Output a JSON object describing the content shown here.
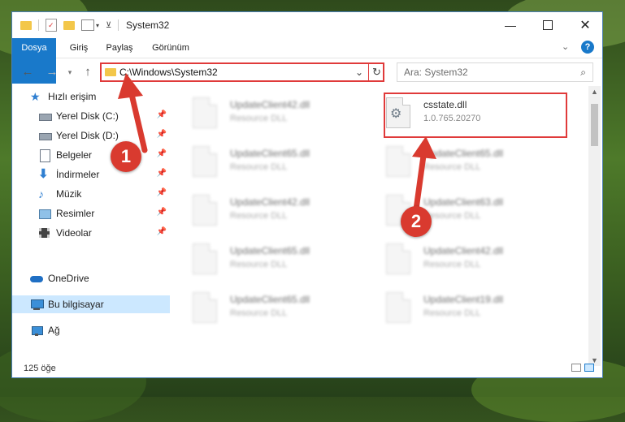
{
  "window": {
    "title": "System32",
    "quick_access_icons": [
      "folder-icon",
      "properties-icon",
      "new-folder-icon",
      "view-icon",
      "dropdown-icon"
    ]
  },
  "ribbon": {
    "tabs": [
      {
        "label": "Dosya",
        "active": true
      },
      {
        "label": "Giriş",
        "active": false
      },
      {
        "label": "Paylaş",
        "active": false
      },
      {
        "label": "Görünüm",
        "active": false
      }
    ]
  },
  "address_bar": {
    "path": "C:\\Windows\\System32"
  },
  "search": {
    "placeholder": "Ara: System32"
  },
  "sidebar": {
    "items": [
      {
        "label": "Hızlı erişim",
        "icon": "star-icon",
        "pinned": false,
        "selected": false
      },
      {
        "label": "Yerel Disk (C:)",
        "icon": "drive-icon",
        "pinned": true,
        "selected": false
      },
      {
        "label": "Yerel Disk (D:)",
        "icon": "drive-icon",
        "pinned": true,
        "selected": false
      },
      {
        "label": "Belgeler",
        "icon": "documents-icon",
        "pinned": true,
        "selected": false
      },
      {
        "label": "İndirmeler",
        "icon": "download-icon",
        "pinned": true,
        "selected": false
      },
      {
        "label": "Müzik",
        "icon": "music-icon",
        "pinned": true,
        "selected": false
      },
      {
        "label": "Resimler",
        "icon": "pictures-icon",
        "pinned": true,
        "selected": false
      },
      {
        "label": "Videolar",
        "icon": "videos-icon",
        "pinned": true,
        "selected": false
      },
      {
        "label": "OneDrive",
        "icon": "cloud-icon",
        "pinned": false,
        "selected": false
      },
      {
        "label": "Bu bilgisayar",
        "icon": "computer-icon",
        "pinned": false,
        "selected": true
      },
      {
        "label": "Ağ",
        "icon": "network-icon",
        "pinned": false,
        "selected": false
      }
    ]
  },
  "files": {
    "left_column": [
      {
        "name": "UpdateClient42.dll",
        "type": "Resource DLL"
      },
      {
        "name": "UpdateClient65.dll",
        "type": "Resource DLL"
      },
      {
        "name": "UpdateClient42.dll",
        "type": "Resource DLL"
      },
      {
        "name": "UpdateClient65.dll",
        "type": "Resource DLL"
      },
      {
        "name": "UpdateClient65.dll",
        "type": "Resource DLL"
      }
    ],
    "right_column": [
      {
        "name": "csstate.dll",
        "type": "1.0.765.20270",
        "highlighted": true
      },
      {
        "name": "UpdateClient65.dll",
        "type": "Resource DLL"
      },
      {
        "name": "UpdateClient63.dll",
        "type": "Resource DLL"
      },
      {
        "name": "UpdateClient42.dll",
        "type": "Resource DLL"
      },
      {
        "name": "UpdateClient19.dll",
        "type": "Resource DLL"
      }
    ]
  },
  "status": {
    "item_count": "125 öğe"
  },
  "callouts": {
    "one": "1",
    "two": "2"
  },
  "colors": {
    "accent": "#1979ca",
    "highlight": "#e03a3a",
    "callout": "#d93a2f",
    "selected_nav": "#cce8ff"
  }
}
